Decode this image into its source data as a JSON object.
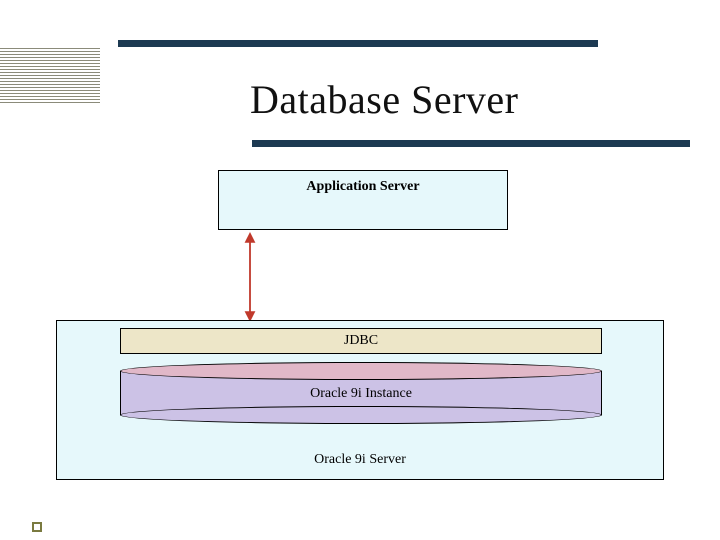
{
  "title": "Database Server",
  "boxes": {
    "app_server": "Application Server",
    "jdbc": "JDBC",
    "instance": "Oracle 9i Instance",
    "server": "Oracle 9i Server"
  },
  "colors": {
    "rule": "#1d3a52",
    "app_box_bg": "#e6f8fb",
    "jdbc_bg": "#ede6c8",
    "cylinder_top": "#e1b8c8",
    "cylinder_body": "#ccc2e6",
    "arrow": "#c0392b"
  }
}
